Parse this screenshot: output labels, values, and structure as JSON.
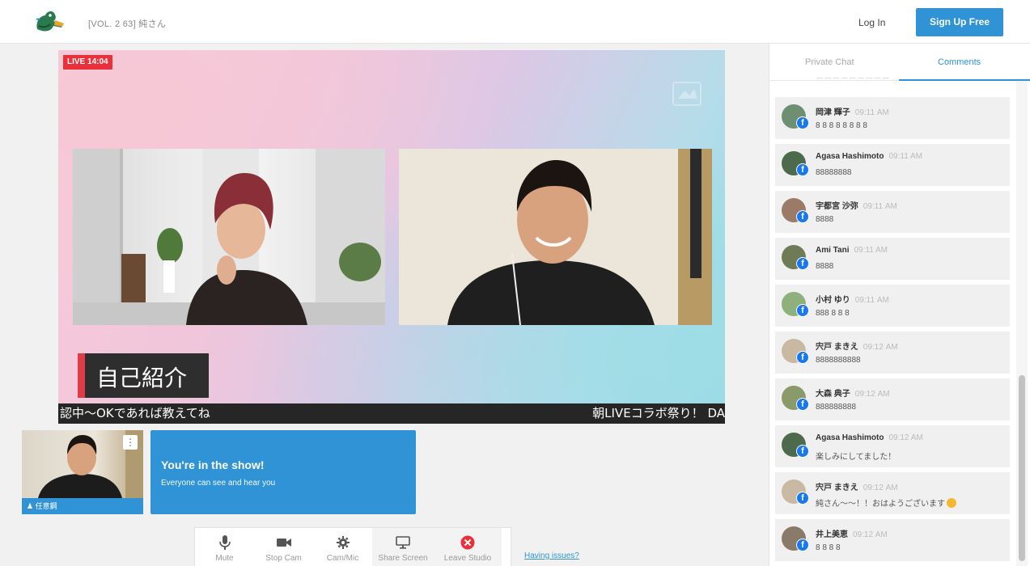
{
  "header": {
    "title": "[VOL. 2 63] 純さん",
    "login": "Log In",
    "signup": "Sign Up Free"
  },
  "stage": {
    "live_badge": "LIVE 14:04",
    "lower_third": "自己紹介",
    "ticker_left": "認中〜OKであれば教えてね",
    "ticker_right": "朝LIVEコラボ祭り！ DA"
  },
  "self_view": {
    "name": "任意鋼"
  },
  "in_show": {
    "heading": "You're in the show!",
    "subtext": "Everyone can see and hear you"
  },
  "toolbar": {
    "mute": "Mute",
    "stop_cam": "Stop Cam",
    "cam_mic": "Cam/Mic",
    "share_screen": "Share Screen",
    "leave_studio": "Leave Studio",
    "having_issues": "Having issues?"
  },
  "sidebar": {
    "tab_private": "Private Chat",
    "tab_comments": "Comments",
    "comments": [
      {
        "name": "岡津 輝子",
        "time": "09:11 AM",
        "text": "8 8 8 8 8 8 8 8",
        "avatar_color": "#6f8f72"
      },
      {
        "name": "Agasa Hashimoto",
        "time": "09:11 AM",
        "text": "88888888",
        "avatar_color": "#4d6a4c"
      },
      {
        "name": "宇都宮 沙弥",
        "time": "09:11 AM",
        "text": "8888",
        "avatar_color": "#9c7a68"
      },
      {
        "name": "Ami Tani",
        "time": "09:11 AM",
        "text": "8888",
        "avatar_color": "#6e7b55"
      },
      {
        "name": "小村 ゆり",
        "time": "09:11 AM",
        "text": "888 8 8 8",
        "avatar_color": "#8fb07c"
      },
      {
        "name": "宍戸 まきえ",
        "time": "09:12 AM",
        "text": "8888888888",
        "avatar_color": "#c9b8a2"
      },
      {
        "name": "大森 典子",
        "time": "09:12 AM",
        "text": "888888888",
        "avatar_color": "#8a9a6a"
      },
      {
        "name": "Agasa Hashimoto",
        "time": "09:12 AM",
        "text": "楽しみにしてました！",
        "avatar_color": "#4d6a4c"
      },
      {
        "name": "宍戸 まきえ",
        "time": "09:12 AM",
        "text": "純さん〜〜！！おはようございます",
        "avatar_color": "#c9b8a2",
        "emoji": true
      },
      {
        "name": "井上美恵",
        "time": "09:12 AM",
        "text": "8 8 8 8",
        "avatar_color": "#8a7a6a"
      }
    ]
  }
}
